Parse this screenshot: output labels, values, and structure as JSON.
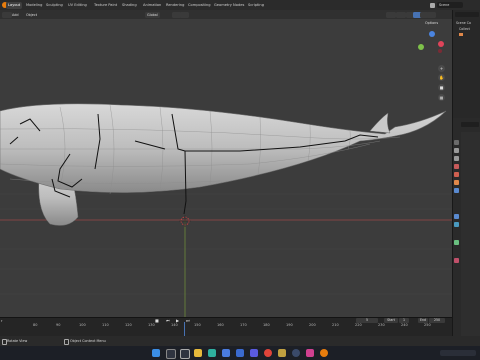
{
  "workspace_tabs": [
    "Layout",
    "Modeling",
    "Sculpting",
    "UV Editing",
    "Texture Paint",
    "Shading",
    "Animation",
    "Rendering",
    "Compositing",
    "Geometry Nodes",
    "Scripting"
  ],
  "active_tab_index": 0,
  "scene_name": "Scene",
  "viewport_header": {
    "mode": "Add",
    "object_menu": "Object",
    "transform": "Global",
    "options": "Options"
  },
  "outliner": {
    "items": [
      "Scene Co",
      "Collect"
    ]
  },
  "timeline": {
    "ticks": [
      "80",
      "90",
      "100",
      "110",
      "120",
      "130",
      "140",
      "150",
      "160",
      "170",
      "180",
      "190",
      "200",
      "210",
      "220",
      "230",
      "240",
      "250"
    ],
    "current_frame": "5",
    "start_label": "Start",
    "start_value": "1",
    "end_label": "End",
    "end_value": "250",
    "left_label": "r"
  },
  "statusbar": {
    "left_action": "Rotate View",
    "right_action": "Object Context Menu"
  },
  "colors": {
    "accent": "#4772b3",
    "gizmo_x": "#e0445a",
    "gizmo_y": "#7ec14a",
    "gizmo_z": "#4a84e0"
  }
}
